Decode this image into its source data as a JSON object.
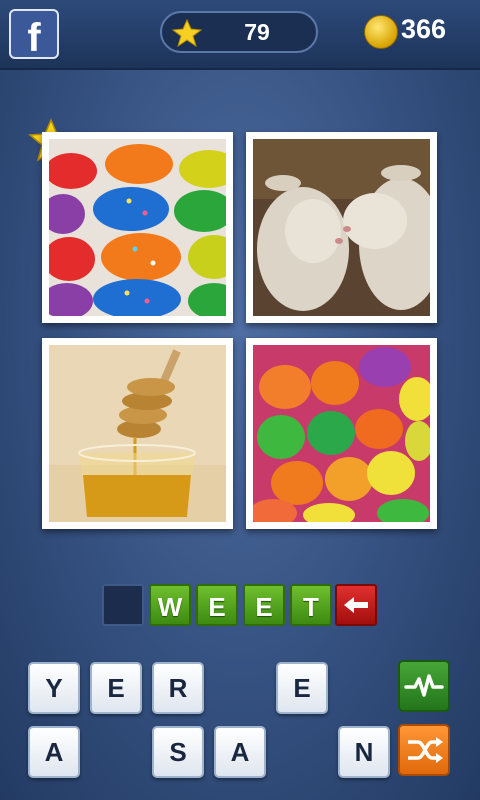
{
  "header": {
    "facebook_icon": "facebook-icon",
    "score": "79",
    "coins": "366"
  },
  "puzzle": {
    "pictures": [
      {
        "name": "cupcakes"
      },
      {
        "name": "lambs"
      },
      {
        "name": "honey"
      },
      {
        "name": "candy"
      }
    ]
  },
  "answer": {
    "slots": [
      "",
      "W",
      "E",
      "E",
      "T"
    ]
  },
  "keyboard": {
    "row1": [
      "Y",
      "E",
      "R",
      "",
      "E"
    ],
    "row2": [
      "A",
      "",
      "S",
      "A",
      "",
      "N"
    ]
  },
  "colors": {
    "slot_filled": "#4c9a1a",
    "backspace": "#c4201e",
    "hint_button": "#3a9a2c",
    "shuffle_button": "#f27f1b"
  }
}
